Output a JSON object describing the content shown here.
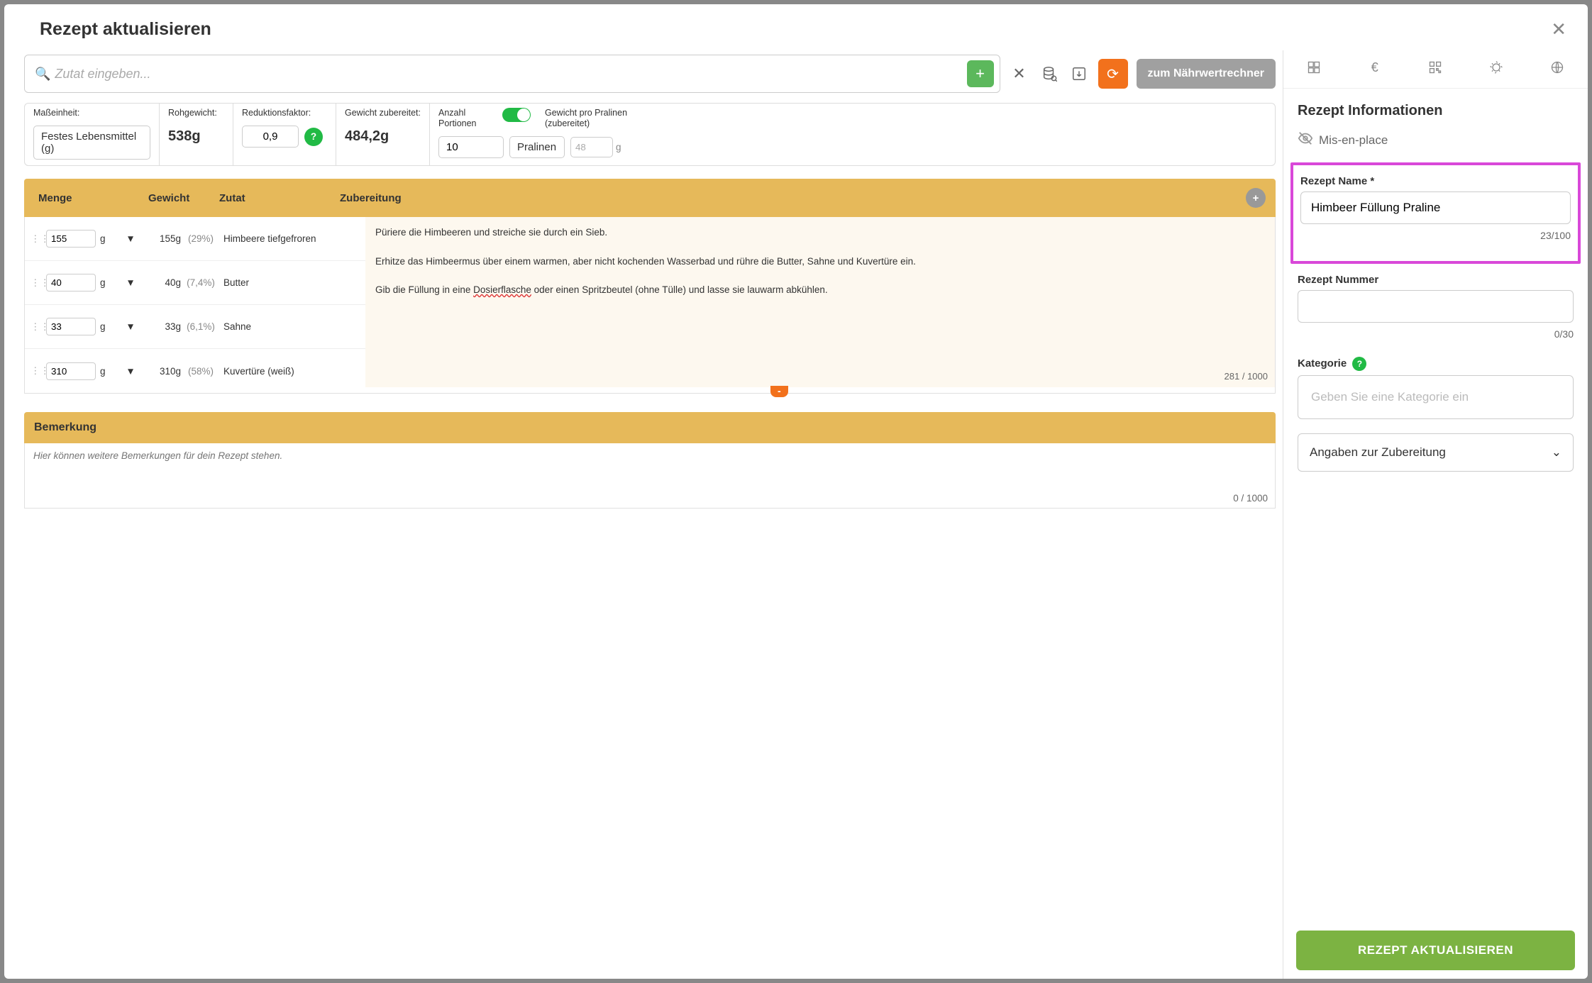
{
  "modal": {
    "title": "Rezept aktualisieren"
  },
  "toolbar": {
    "search_placeholder": "Zutat eingeben...",
    "calc_button": "zum Nährwertrechner"
  },
  "params": {
    "unit_label": "Maßeinheit:",
    "unit_value": "Festes Lebensmittel (g)",
    "raw_label": "Rohgewicht:",
    "raw_value": "538g",
    "reduction_label": "Reduktionsfaktor:",
    "reduction_value": "0,9",
    "cooked_label": "Gewicht zubereitet:",
    "cooked_value": "484,2g",
    "portions_label": "Anzahl Portionen",
    "portions_value": "10",
    "portion_name": "Pralinen",
    "wpp_label": "Gewicht pro Pralinen (zubereitet)",
    "wpp_value": "48",
    "wpp_unit": "g"
  },
  "table": {
    "headers": {
      "menge": "Menge",
      "gewicht": "Gewicht",
      "zutat": "Zutat",
      "zubereitung": "Zubereitung"
    },
    "rows": [
      {
        "amount": "155",
        "unit": "g",
        "weight": "155g",
        "pct": "(29%)",
        "ingredient": "Himbeere tiefgefroren"
      },
      {
        "amount": "40",
        "unit": "g",
        "weight": "40g",
        "pct": "(7,4%)",
        "ingredient": "Butter"
      },
      {
        "amount": "33",
        "unit": "g",
        "weight": "33g",
        "pct": "(6,1%)",
        "ingredient": "Sahne"
      },
      {
        "amount": "310",
        "unit": "g",
        "weight": "310g",
        "pct": "(58%)",
        "ingredient": "Kuvertüre (weiß)"
      }
    ],
    "preparation": {
      "p1": "Püriere die Himbeeren und streiche sie durch ein Sieb.",
      "p2": "Erhitze das Himbeermus über einem warmen, aber nicht kochenden Wasserbad und rühre die Butter, Sahne und Kuvertüre ein.",
      "p3a": "Gib die Füllung in eine ",
      "p3b": "Dosierflasche",
      "p3c": " oder einen Spritzbeutel (ohne Tülle) und lasse sie lauwarm abkühlen.",
      "count": "281 / 1000"
    }
  },
  "remark": {
    "header": "Bemerkung",
    "placeholder": "Hier können weitere Bemerkungen für dein Rezept stehen.",
    "count": "0 / 1000"
  },
  "right": {
    "section_title": "Rezept Informationen",
    "mise": "Mis-en-place",
    "name_label": "Rezept Name *",
    "name_value": "Himbeer Füllung Praline",
    "name_count": "23/100",
    "number_label": "Rezept Nummer",
    "number_value": "",
    "number_count": "0/30",
    "category_label": "Kategorie",
    "category_placeholder": "Geben Sie eine Kategorie ein",
    "accordion": "Angaben zur Zubereitung",
    "save_button": "REZEPT AKTUALISIEREN"
  }
}
